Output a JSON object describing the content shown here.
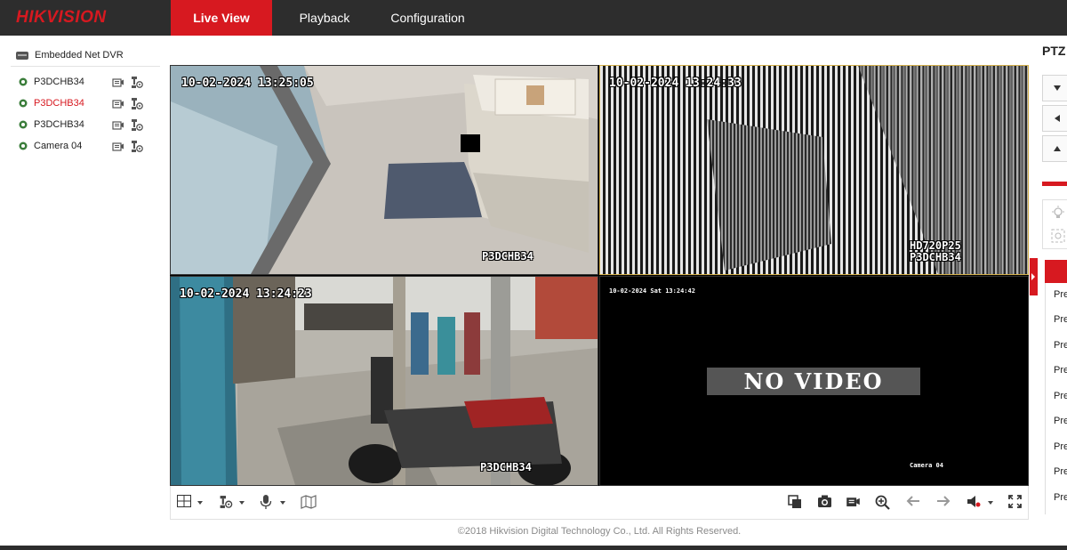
{
  "header": {
    "logo": "HIKVISION",
    "tabs": [
      {
        "label": "Live View",
        "active": true
      },
      {
        "label": "Playback",
        "active": false
      },
      {
        "label": "Configuration",
        "active": false
      }
    ]
  },
  "sidebar": {
    "root_label": "Embedded Net DVR",
    "cameras": [
      {
        "label": "P3DCHB34",
        "selected": false
      },
      {
        "label": "P3DCHB34",
        "selected": true
      },
      {
        "label": "P3DCHB34",
        "selected": false
      },
      {
        "label": "Camera 04",
        "selected": false
      }
    ]
  },
  "video": {
    "tiles": [
      {
        "timestamp": "10-02-2024 13:25:05",
        "name": "P3DCHB34"
      },
      {
        "timestamp": "10-02-2024 13:24:33",
        "resolution": "HD720P25",
        "name": "P3DCHB34"
      },
      {
        "timestamp": "10-02-2024 13:24:23",
        "name": "P3DCHB34"
      },
      {
        "timestamp": "10-02-2024 Sat 13:24:42",
        "no_video": "NO VIDEO",
        "name": "Camera 04"
      }
    ]
  },
  "footer": {
    "copyright": "©2018 Hikvision Digital Technology Co., Ltd. All Rights Reserved."
  },
  "ptz": {
    "title": "PTZ",
    "presets": [
      "Pre",
      "Pre",
      "Pre",
      "Pre",
      "Pre",
      "Pre",
      "Pre",
      "Pre",
      "Pre"
    ]
  },
  "colors": {
    "brand_red": "#d71920",
    "topbar": "#2d2d2d",
    "selected_tile_border": "#d4b04a"
  }
}
